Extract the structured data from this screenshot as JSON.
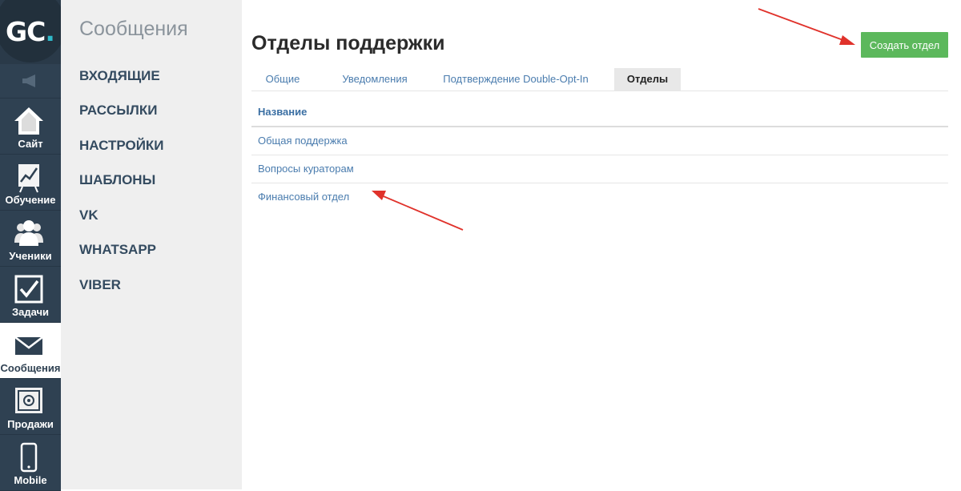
{
  "logo": {
    "text": "GC",
    "dot": "."
  },
  "rail": [
    {
      "label": "Сайт",
      "icon": "home-icon"
    },
    {
      "label": "Обучение",
      "icon": "chart-board-icon"
    },
    {
      "label": "Ученики",
      "icon": "users-icon"
    },
    {
      "label": "Задачи",
      "icon": "checkbox-icon"
    },
    {
      "label": "Сообщения",
      "icon": "envelope-icon",
      "active": true
    },
    {
      "label": "Продажи",
      "icon": "safe-icon"
    },
    {
      "label": "Mobile",
      "icon": "phone-icon"
    }
  ],
  "sidebar": {
    "title": "Сообщения",
    "links": [
      "ВХОДЯЩИЕ",
      "РАССЫЛКИ",
      "НАСТРОЙКИ",
      "ШАБЛОНЫ",
      "VK",
      "WHATSAPP",
      "VIBER"
    ]
  },
  "main": {
    "title": "Отделы поддержки",
    "create_button": "Создать отдел",
    "tabs": [
      {
        "label": "Общие"
      },
      {
        "label": "Уведомления"
      },
      {
        "label": "Подтверждение Double-Opt-In"
      },
      {
        "label": "Отделы",
        "active": true
      }
    ],
    "table": {
      "header": "Название",
      "rows": [
        "Общая поддержка",
        "Вопросы кураторам",
        "Финансовый отдел"
      ]
    }
  },
  "colors": {
    "rail_bg": "#2f4152",
    "button_green": "#5cb85c",
    "link_blue": "#4a7cae",
    "annotation_red": "#e0322b"
  }
}
